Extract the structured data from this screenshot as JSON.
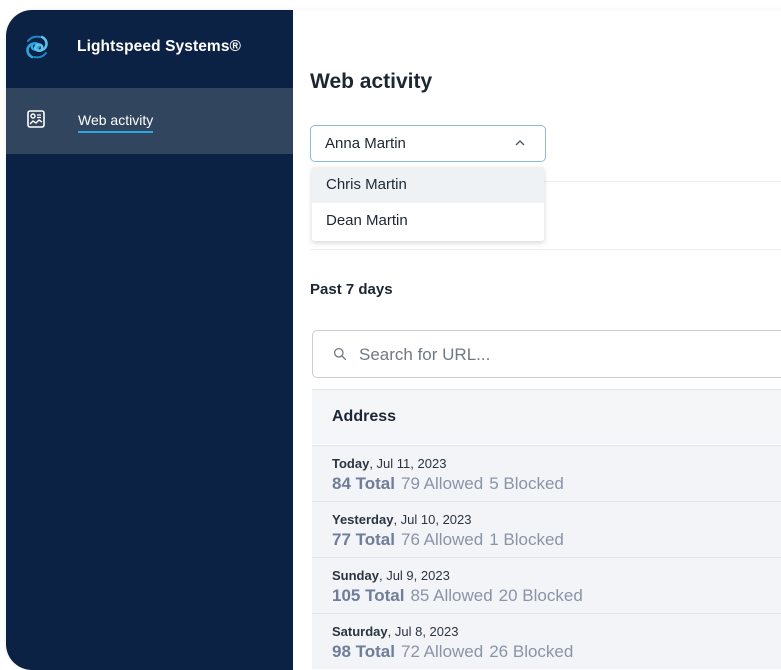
{
  "brand": {
    "name": "Lightspeed Systems®",
    "accent_color": "#2ea6e0",
    "logo_icon": "lightspeed-logo-icon"
  },
  "sidebar": {
    "background": "#0c2244",
    "items": [
      {
        "label": "Web activity",
        "icon": "activity-chart-icon",
        "active": true
      }
    ]
  },
  "main": {
    "title": "Web activity",
    "student_select": {
      "value": "Anna Martin",
      "expanded": true,
      "options": [
        "Chris Martin",
        "Dean Martin"
      ]
    },
    "range_label": "Past 7 days",
    "search": {
      "placeholder": "Search for URL...",
      "value": ""
    },
    "table": {
      "header": "Address",
      "rows": [
        {
          "day": "Today",
          "date": ", Jul 11, 2023",
          "total": "84 Total",
          "allowed": "79 Allowed",
          "blocked": "5 Blocked"
        },
        {
          "day": "Yesterday",
          "date": ", Jul 10, 2023",
          "total": "77 Total",
          "allowed": "76 Allowed",
          "blocked": "1 Blocked"
        },
        {
          "day": "Sunday",
          "date": ", Jul 9, 2023",
          "total": "105 Total",
          "allowed": "85 Allowed",
          "blocked": "20 Blocked"
        },
        {
          "day": "Saturday",
          "date": ", Jul 8, 2023",
          "total": "98 Total",
          "allowed": "72 Allowed",
          "blocked": "26 Blocked"
        }
      ]
    }
  }
}
